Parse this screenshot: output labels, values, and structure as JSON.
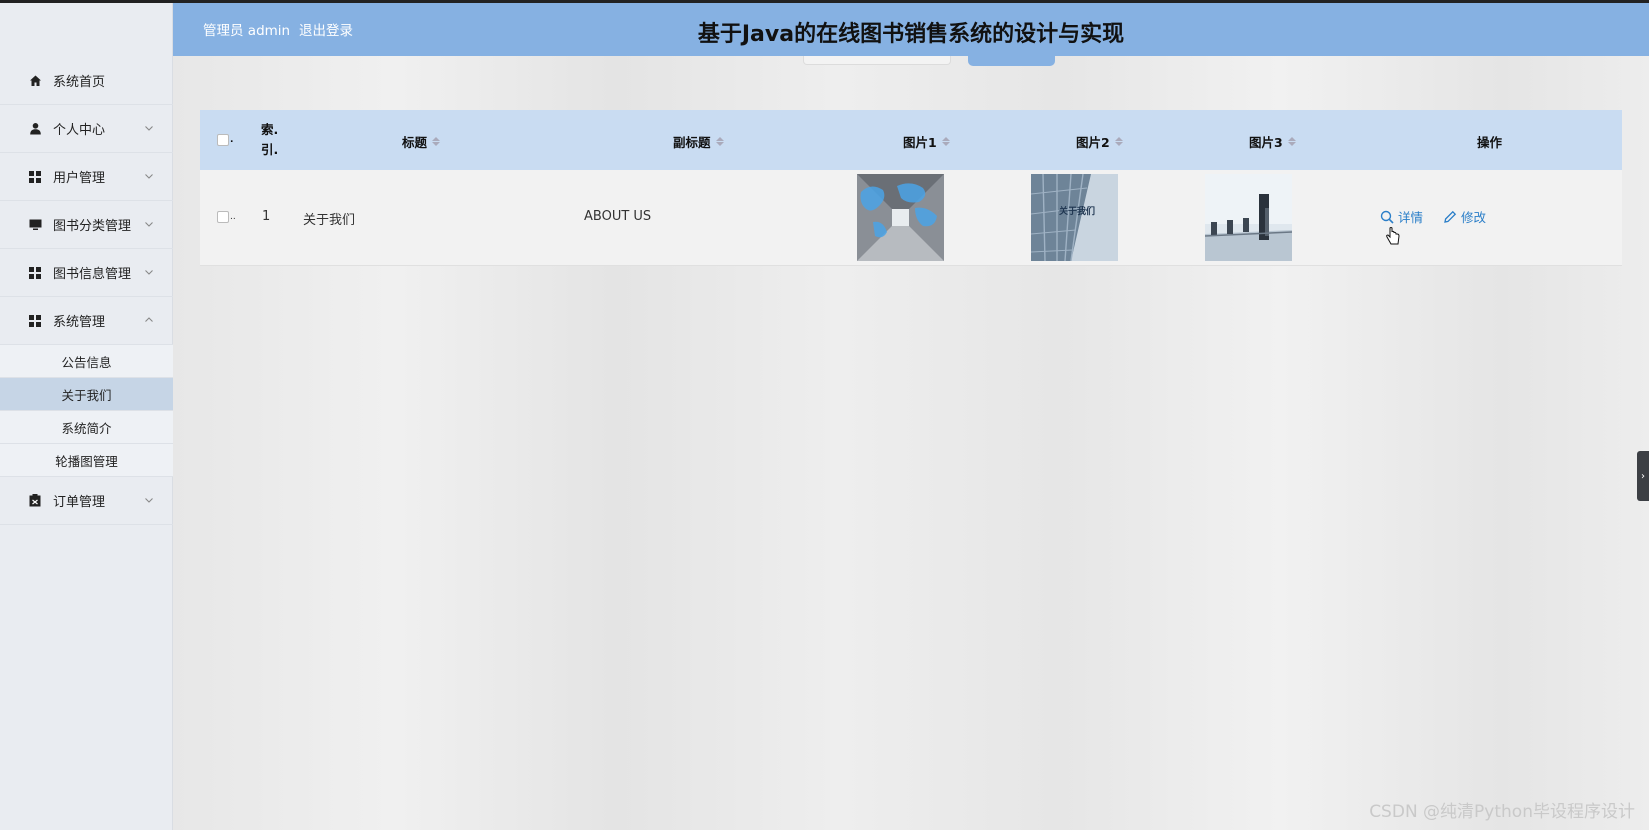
{
  "header": {
    "user": "管理员 admin",
    "logout": "退出登录",
    "title": "基于Java的在线图书销售系统的设计与实现"
  },
  "sidebar": {
    "items": [
      {
        "label": "系统首页",
        "icon": "home-icon"
      },
      {
        "label": "个人中心",
        "icon": "user-icon"
      },
      {
        "label": "用户管理",
        "icon": "grid-icon"
      },
      {
        "label": "图书分类管理",
        "icon": "monitor-icon"
      },
      {
        "label": "图书信息管理",
        "icon": "grid-icon"
      },
      {
        "label": "系统管理",
        "icon": "grid-icon"
      }
    ],
    "sub_items": [
      "公告信息",
      "关于我们",
      "系统简介",
      "轮播图管理"
    ],
    "active_sub": "关于我们",
    "last_item": {
      "label": "订单管理",
      "icon": "clipboard-icon"
    }
  },
  "table": {
    "headers": {
      "index_line1": "索.",
      "index_line2": "引.",
      "title": "标题",
      "subtitle": "副标题",
      "image1": "图片1",
      "image2": "图片2",
      "image3": "图片3",
      "actions": "操作"
    },
    "rows": [
      {
        "index": "1",
        "title": "关于我们",
        "subtitle": "ABOUT US",
        "image2_text": "关于我们",
        "detail_label": "详情",
        "edit_label": "修改"
      }
    ]
  },
  "watermark": "CSDN @纯清Python毕设程序设计",
  "colors": {
    "header_bg": "#86b1e2",
    "table_header_bg": "#c9dcf2",
    "link": "#2a7ec8",
    "active_sub_bg": "#c6d5e6"
  }
}
